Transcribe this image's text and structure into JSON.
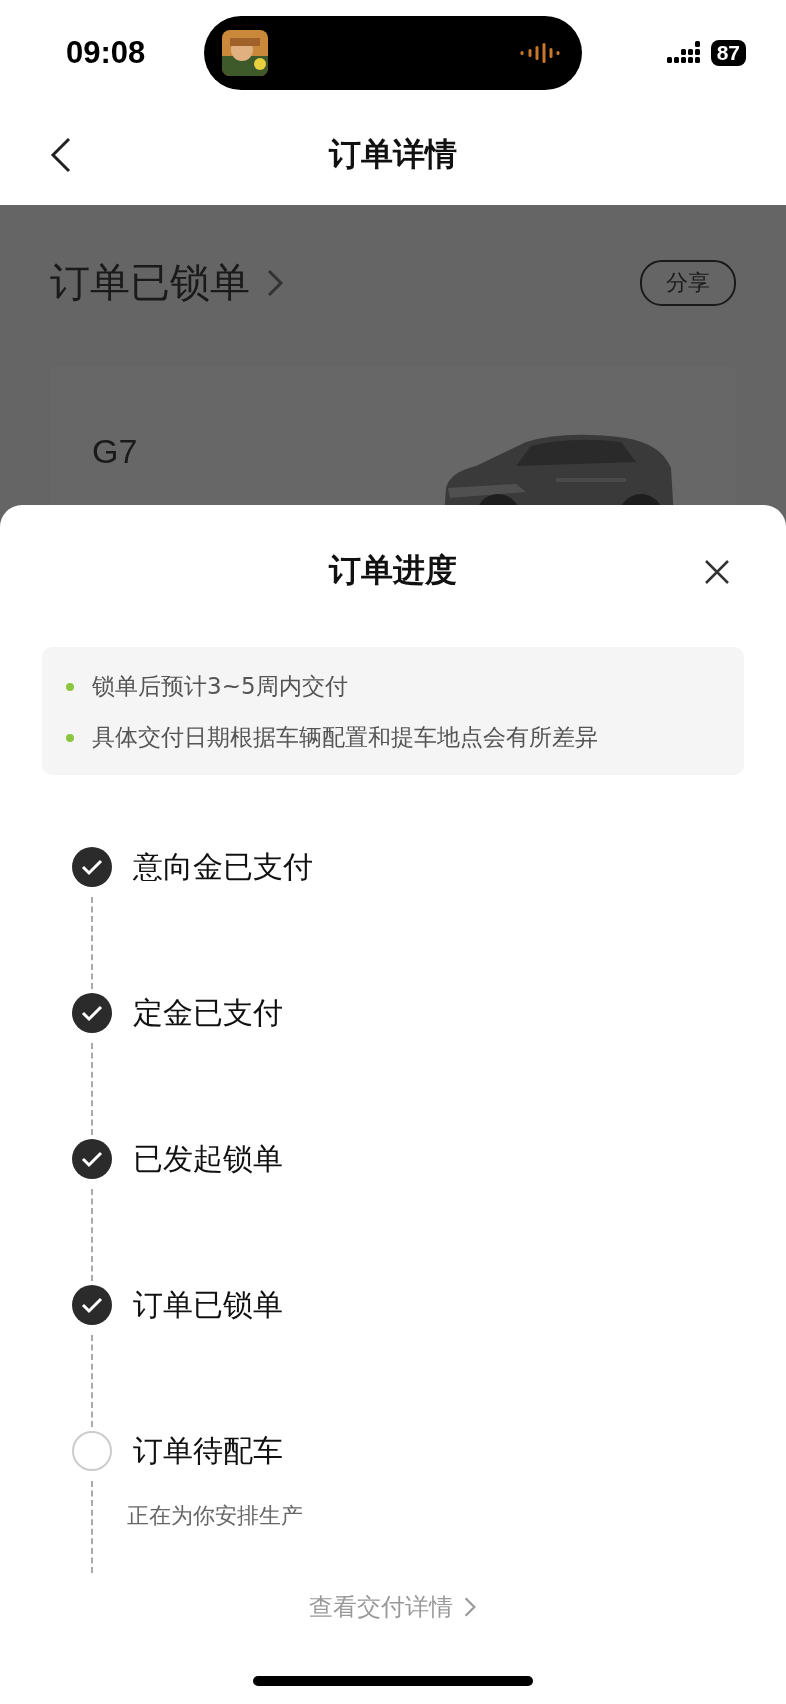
{
  "status_bar": {
    "time": "09:08",
    "battery": "87"
  },
  "nav": {
    "title": "订单详情"
  },
  "order": {
    "status": "订单已锁单",
    "share_button": "分享",
    "model": "G7"
  },
  "sheet": {
    "title": "订单进度",
    "notes": [
      "锁单后预计3~5周内交付",
      "具体交付日期根据车辆配置和提车地点会有所差异"
    ],
    "steps": [
      {
        "title": "意向金已支付",
        "completed": true
      },
      {
        "title": "定金已支付",
        "completed": true
      },
      {
        "title": "已发起锁单",
        "completed": true
      },
      {
        "title": "订单已锁单",
        "completed": true
      },
      {
        "title": "订单待配车",
        "completed": false,
        "subtitle": "正在为你安排生产"
      }
    ],
    "link": "查看交付详情"
  }
}
